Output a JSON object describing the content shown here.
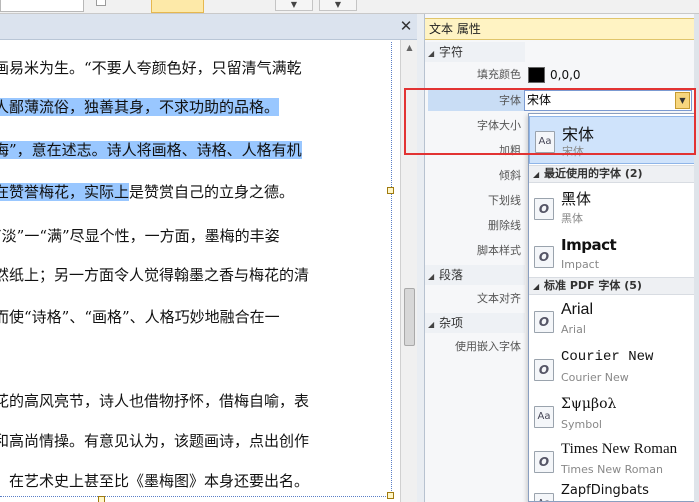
{
  "toolbar": {
    "arrow_left": "▼",
    "arrow_right": "▼"
  },
  "document": {
    "close_glyph": "✕",
    "lines": [
      {
        "pre": "画易米为生。“不要人夸颜色好，只留清气满乾",
        "sel": "",
        "post": ""
      },
      {
        "pre": "",
        "sel": "人鄙薄流俗，独善其身，不求功助的品格。",
        "post": ""
      },
      {
        "pre": "",
        "sel": "海”，意在述志。诗人将画格、诗格、人格有机",
        "post": ""
      },
      {
        "pre": "",
        "sel": "在赞誉梅花，实际上",
        "post": "是赞赏自己的立身之德。"
      },
      {
        "pre": "“淡”一“满”尽显个性，一方面，墨梅的丰姿",
        "sel": "",
        "post": ""
      },
      {
        "pre": "然纸上；另一方面令人觉得翰墨之香与梅花的清",
        "sel": "",
        "post": ""
      },
      {
        "pre": "而使“诗格”、“画格”、人格巧妙地融合在一",
        "sel": "",
        "post": ""
      },
      {
        "pre": "",
        "sel": "",
        "post": ""
      },
      {
        "pre": "花的高风亮节，诗人也借物抒怀，借梅自喻，表",
        "sel": "",
        "post": ""
      },
      {
        "pre": "和高尚情操。有意见认为，该题画诗，点出创作",
        "sel": "",
        "post": ""
      },
      {
        "pre": "，在艺术史上甚至比《墨梅图》本身还要出名。",
        "sel": "",
        "post": ""
      }
    ]
  },
  "panel": {
    "title": "文本 属性",
    "sections": {
      "character": "字符",
      "paragraph": "段落",
      "misc": "杂项"
    },
    "labels": {
      "fill_color": "填充颜色",
      "font": "字体",
      "font_size": "字体大小",
      "bold": "加粗",
      "italic": "倾斜",
      "underline": "下划线",
      "strikethrough": "删除线",
      "script_style": "脚本样式",
      "text_align": "文本对齐",
      "use_embedded_font": "使用嵌入字体"
    },
    "fill_color_value": "0,0,0",
    "fill_color_hex": "#000000",
    "font_value": "宋体"
  },
  "font_dropdown": {
    "selected": {
      "name": "宋体",
      "sub": "宋体",
      "icon": "Aa"
    },
    "recent_header": "最近使用的字体 (2)",
    "recent": [
      {
        "name": "黑体",
        "sub": "黑体",
        "icon": "O"
      },
      {
        "name": "Impact",
        "sub": "Impact",
        "icon": "O"
      }
    ],
    "standard_header": "标准 PDF 字体 (5)",
    "standard": [
      {
        "name": "Arial",
        "sub": "Arial",
        "icon": "O"
      },
      {
        "name": "Courier New",
        "sub": "Courier New",
        "icon": "O"
      },
      {
        "name": "Σψμβολ",
        "sub": "Symbol",
        "icon": "Aa"
      },
      {
        "name": "Times New Roman",
        "sub": "Times New Roman",
        "icon": "O"
      },
      {
        "name": "ZapfDingbats",
        "sub": "",
        "icon": "Aa"
      }
    ]
  },
  "colors": {
    "accent_highlight": "#99c7ff",
    "red_annotation": "#e23333",
    "panel_title_bg": "#fff3c3"
  }
}
